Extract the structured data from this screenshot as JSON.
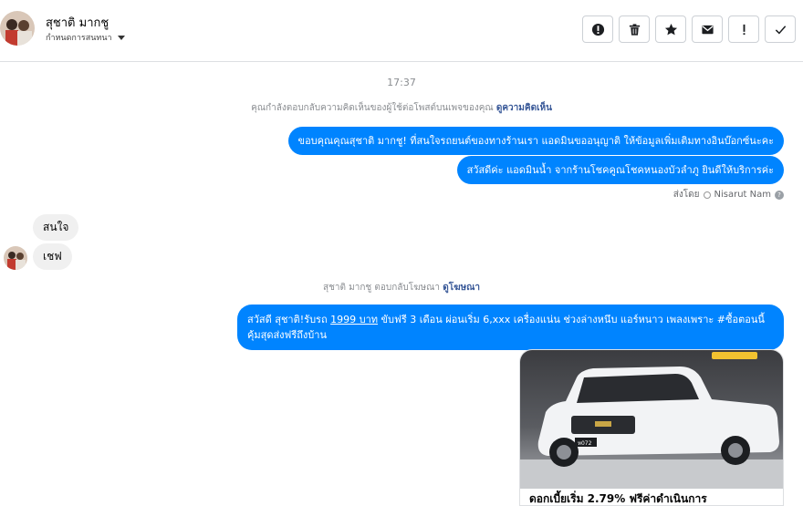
{
  "header": {
    "contact_name": "สุชาติ มากชู",
    "assign_label": "กำหนดการสนทนา"
  },
  "toolbar": {
    "actions": [
      {
        "icon": "alert-circle-icon"
      },
      {
        "icon": "trash-icon"
      },
      {
        "icon": "star-icon"
      },
      {
        "icon": "envelope-icon"
      },
      {
        "icon": "exclamation-icon"
      },
      {
        "icon": "check-icon"
      }
    ]
  },
  "conversation": {
    "timestamp": "17:37",
    "system_notice_1": {
      "text": "คุณกำลังตอบกลับความคิดเห็นของผู้ใช้ต่อโพสต์บนเพจของคุณ",
      "link": "ดูความคิดเห็น"
    },
    "messages_out_1": [
      "ขอบคุณคุณสุชาติ มากชู! ที่สนใจรถยนต์ของทางร้านเรา แอดมินขออนุญาติ ให้ข้อมูลเพิ่มเติมทางอินบ๊อกซ์นะคะ",
      "สวัสดีค่ะ แอดมินน้ำ จากร้านโชคคูณโชคหนองบัวลำภู ยินดีให้บริการค่ะ"
    ],
    "sent_by": {
      "label": "ส่งโดย",
      "name": "Nisarut Nam",
      "help": "?"
    },
    "messages_in": [
      "สนใจ",
      "เชฟ"
    ],
    "system_notice_2": {
      "text": "สุชาติ มากชู ตอบกลับโฆษณา",
      "link": "ดูโฆษณา"
    },
    "ad_reply": {
      "prefix": "สวัสดี สุชาติ!รับรถ ",
      "price": "1999 บาท",
      "suffix": " ขับฟรี 3 เดือน ผ่อนเริ่ม 6,xxx   เครื่องแน่น ช่วงล่างหนึบ แอร์หนาว เพลงเพราะ #ซื้อตอนนี้คุ้มสุดส่งฟรีถึงบ้าน"
    },
    "ad_card": {
      "plate": "ห072",
      "caption": "ดอกเบี้ยเริ่ม 2.79% ฟรีค่าดำเนินการ"
    }
  },
  "colors": {
    "outgoing_bubble": "#0084ff",
    "incoming_bubble": "#f0f0f0",
    "link": "#385898"
  }
}
